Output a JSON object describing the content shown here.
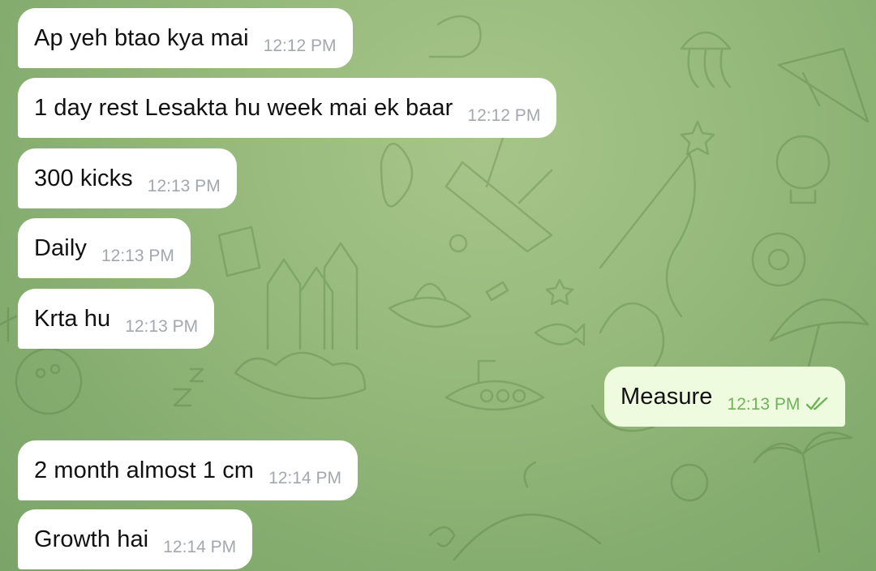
{
  "messages": [
    {
      "text": "Ap yeh btao kya mai",
      "time": "12:12 PM",
      "direction": "in"
    },
    {
      "text": "1 day rest Lesakta hu week mai ek baar",
      "time": "12:12 PM",
      "direction": "in"
    },
    {
      "text": "300 kicks",
      "time": "12:13 PM",
      "direction": "in"
    },
    {
      "text": "Daily",
      "time": "12:13 PM",
      "direction": "in"
    },
    {
      "text": "Krta hu",
      "time": "12:13 PM",
      "direction": "in"
    },
    {
      "text": "Measure",
      "time": "12:13 PM",
      "direction": "out",
      "status_icon": "double-check-icon"
    },
    {
      "text": "2 month almost 1 cm",
      "time": "12:14 PM",
      "direction": "in"
    },
    {
      "text": "Growth hai",
      "time": "12:14 PM",
      "direction": "in"
    }
  ],
  "colors": {
    "incoming_bubble": "#ffffff",
    "outgoing_bubble": "#eefbdf",
    "outgoing_time": "#6fb258",
    "incoming_time": "#a2a8ad",
    "chat_background": "#98bb7d"
  }
}
